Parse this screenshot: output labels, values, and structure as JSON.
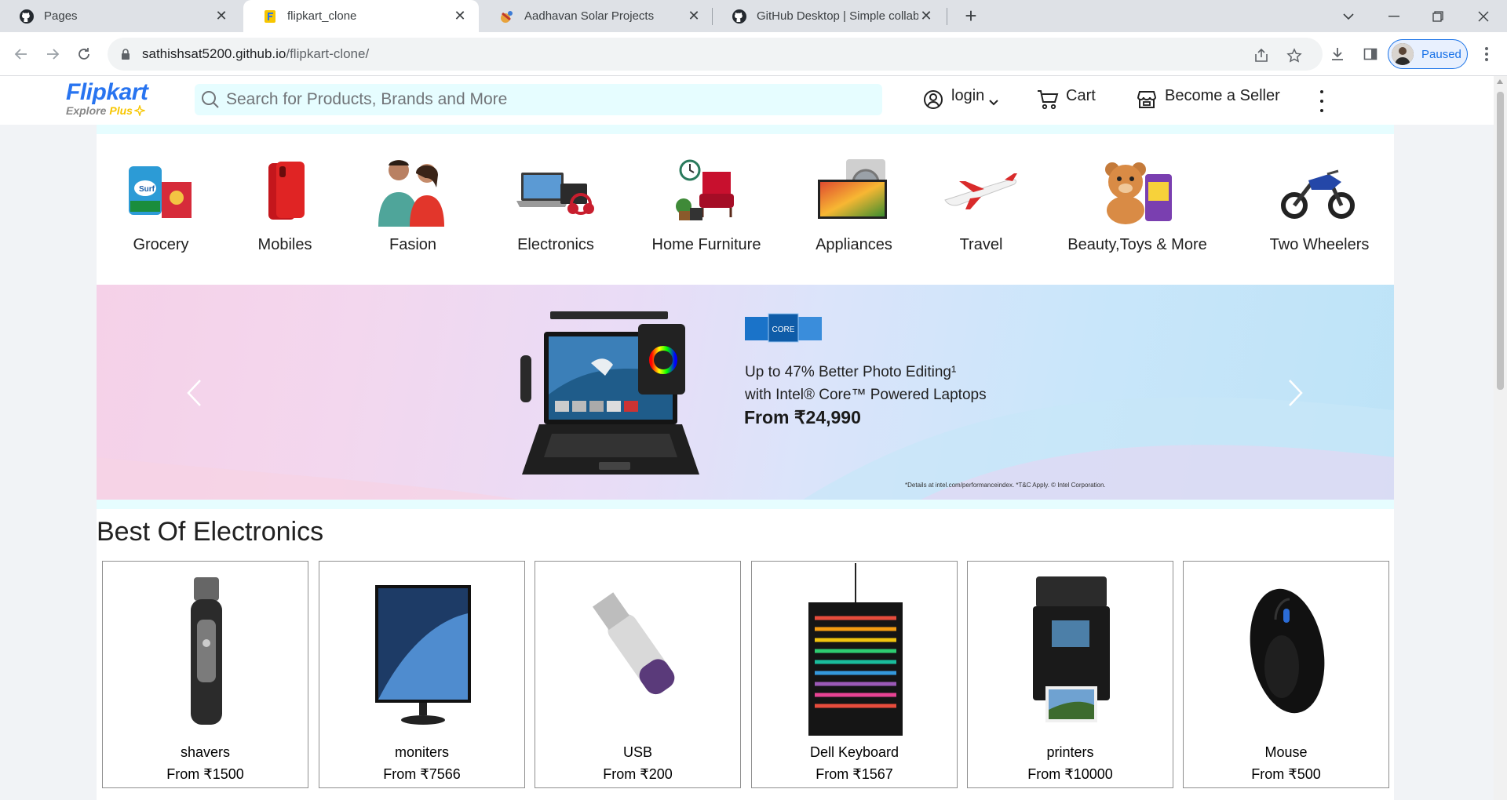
{
  "browser": {
    "tabs": [
      {
        "title": "Pages",
        "icon": "github-icon",
        "active": false
      },
      {
        "title": "flipkart_clone",
        "icon": "flipkart-icon",
        "active": true
      },
      {
        "title": "Aadhavan Solar Projects",
        "icon": "solar-icon",
        "active": false
      },
      {
        "title": "GitHub Desktop | Simple collabo",
        "icon": "github-icon",
        "active": false
      }
    ],
    "url_host": "sathishsat5200.github.io",
    "url_path": "/flipkart-clone/",
    "profile_status": "Paused"
  },
  "header": {
    "brand": "Flipkart",
    "tagline": "Explore",
    "tagline_plus": "Plus",
    "search_placeholder": "Search for Products, Brands and More",
    "login_label": "login",
    "cart_label": "Cart",
    "seller_label": "Become a Seller"
  },
  "categories": [
    {
      "label": "Grocery",
      "icon": "grocery-icon"
    },
    {
      "label": "Mobiles",
      "icon": "mobile-icon"
    },
    {
      "label": "Fasion",
      "icon": "fashion-icon"
    },
    {
      "label": "Electronics",
      "icon": "electronics-icon"
    },
    {
      "label": "Home Furniture",
      "icon": "furniture-icon"
    },
    {
      "label": "Appliances",
      "icon": "appliances-icon"
    },
    {
      "label": "Travel",
      "icon": "airplane-icon"
    },
    {
      "label": "Beauty,Toys & More",
      "icon": "toys-icon"
    },
    {
      "label": "Two Wheelers",
      "icon": "motorbike-icon"
    }
  ],
  "banner": {
    "chip_label": "CORE",
    "line1": "Up to 47% Better Photo Editing¹",
    "line2": "with Intel® Core™ Powered Laptops",
    "price": "From ₹24,990",
    "fine_print": "*Details at intel.com/performanceindex. *T&C Apply. © Intel Corporation."
  },
  "best_of_electronics": {
    "title": "Best Of Electronics",
    "products": [
      {
        "name": "shavers",
        "price": "From ₹1500"
      },
      {
        "name": "moniters",
        "price": "From ₹7566"
      },
      {
        "name": "USB",
        "price": "From ₹200"
      },
      {
        "name": "Dell Keyboard",
        "price": "From ₹1567"
      },
      {
        "name": "printers",
        "price": "From ₹10000"
      },
      {
        "name": "Mouse",
        "price": "From ₹500"
      }
    ]
  },
  "colors": {
    "brand_blue": "#2874f0",
    "search_bg": "#e6fdff",
    "plus_yellow": "#f7c600"
  }
}
